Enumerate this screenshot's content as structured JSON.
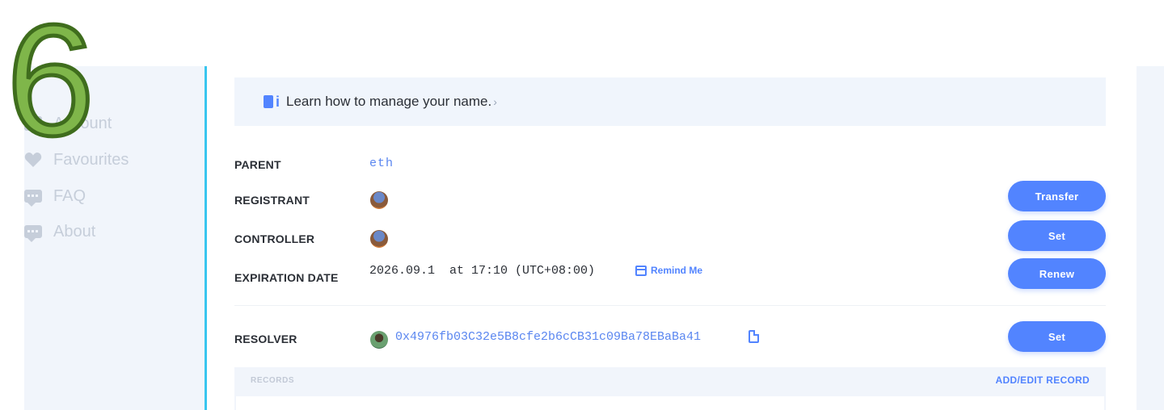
{
  "overlay": {
    "step_number": "6"
  },
  "sidebar": {
    "items": [
      {
        "label": "Account",
        "icon": "account-icon"
      },
      {
        "label": "Favourites",
        "icon": "heart-icon"
      },
      {
        "label": "FAQ",
        "icon": "chat-icon"
      },
      {
        "label": "About",
        "icon": "chat-icon"
      }
    ]
  },
  "banner": {
    "text": "Learn how to manage your name.",
    "arrow": "›"
  },
  "details": {
    "parent": {
      "label": "PARENT",
      "value": "eth"
    },
    "registrant": {
      "label": "REGISTRANT",
      "button": "Transfer"
    },
    "controller": {
      "label": "CONTROLLER",
      "button": "Set"
    },
    "expiration": {
      "label": "EXPIRATION DATE",
      "value": "2026.09.1  at 17:10 (UTC+08:00)",
      "remind": "Remind Me",
      "button": "Renew"
    },
    "resolver": {
      "label": "RESOLVER",
      "value": "0x4976fb03C32e5B8cfe2b6cCB31c09Ba78EBaBa41",
      "button": "Set"
    }
  },
  "records": {
    "label": "RECORDS",
    "action": "ADD/EDIT RECORD"
  },
  "colors": {
    "accent": "#5284ff",
    "sidebar_bg": "#f1f5fb",
    "sidebar_border": "#39c6ef"
  }
}
